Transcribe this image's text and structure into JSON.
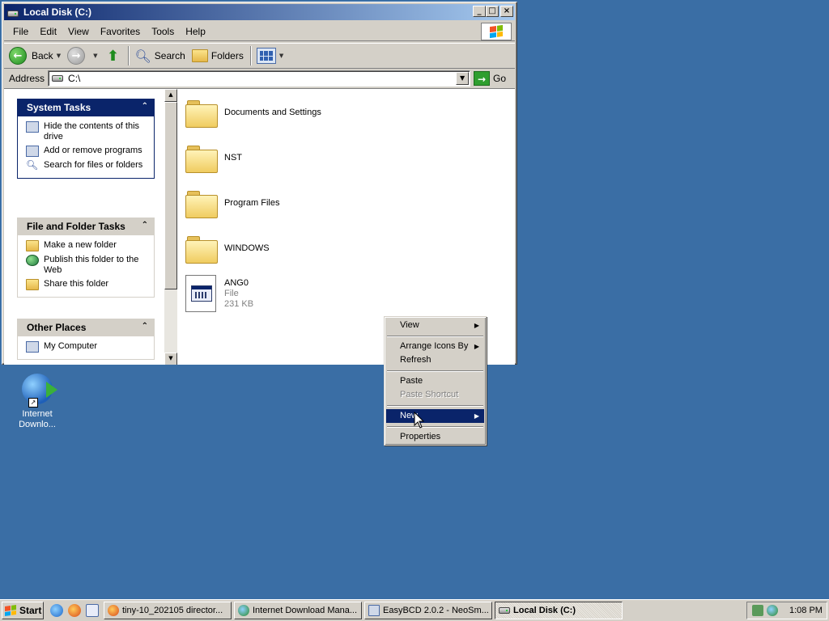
{
  "window": {
    "title": "Local Disk (C:)",
    "minimize": "_",
    "maximize": "□",
    "close": "×"
  },
  "menubar": [
    "File",
    "Edit",
    "View",
    "Favorites",
    "Tools",
    "Help"
  ],
  "toolbar": {
    "back": "Back",
    "search": "Search",
    "folders": "Folders"
  },
  "address": {
    "label": "Address",
    "value": "C:\\",
    "go": "Go"
  },
  "taskpane": {
    "system_tasks": {
      "title": "System Tasks",
      "items": [
        "Hide the contents of this drive",
        "Add or remove programs",
        "Search for files or folders"
      ]
    },
    "file_folder_tasks": {
      "title": "File and Folder Tasks",
      "items": [
        "Make a new folder",
        "Publish this folder to the Web",
        "Share this folder"
      ]
    },
    "other_places": {
      "title": "Other Places",
      "items": [
        "My Computer"
      ]
    }
  },
  "files": [
    {
      "name": "Documents and Settings"
    },
    {
      "name": "NST"
    },
    {
      "name": "Program Files"
    },
    {
      "name": "WINDOWS"
    },
    {
      "name": "ANG0",
      "type": "File",
      "size": "231 KB"
    }
  ],
  "context_menu": {
    "view": "View",
    "arrange": "Arrange Icons By",
    "refresh": "Refresh",
    "paste": "Paste",
    "paste_shortcut": "Paste Shortcut",
    "new": "New",
    "properties": "Properties"
  },
  "desktop": {
    "icon_label": "Internet Downlo..."
  },
  "taskbar": {
    "start": "Start",
    "tasks": [
      "tiny-10_202105 director...",
      "Internet Download Mana...",
      "EasyBCD 2.0.2 - NeoSm...",
      "Local Disk (C:)"
    ],
    "clock": "1:08 PM"
  }
}
